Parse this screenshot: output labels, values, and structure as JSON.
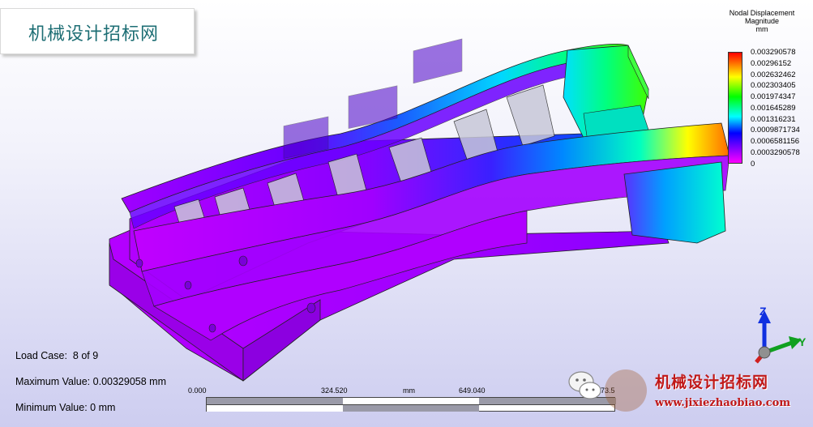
{
  "brand": {
    "title": "机械设计招标网"
  },
  "legend": {
    "title_lines": [
      "Nodal Displacement",
      "Magnitude",
      "mm"
    ],
    "ticks": [
      "0.003290578",
      "0.00296152",
      "0.002632462",
      "0.002303405",
      "0.001974347",
      "0.001645289",
      "0.001316231",
      "0.0009871734",
      "0.0006581156",
      "0.0003290578",
      "0"
    ],
    "colors": [
      "#ff0000",
      "#ffff00",
      "#00ff00",
      "#00ffff",
      "#0000ff",
      "#ff00ff"
    ]
  },
  "info": {
    "load_case_label": "Load Case:",
    "load_case_value": "8 of 9",
    "max_label": "Maximum Value:",
    "max_value": "0.00329058 mm",
    "min_label": "Minimum Value:",
    "min_value": "0 mm"
  },
  "scale": {
    "labels": [
      "0.000",
      "324.520",
      "mm",
      "649.040",
      "973.5"
    ]
  },
  "triad": {
    "z": "Z",
    "y": "Y"
  },
  "watermark": {
    "text": "机械设计招标网",
    "url": "www.jixiezhaobiao.com"
  }
}
